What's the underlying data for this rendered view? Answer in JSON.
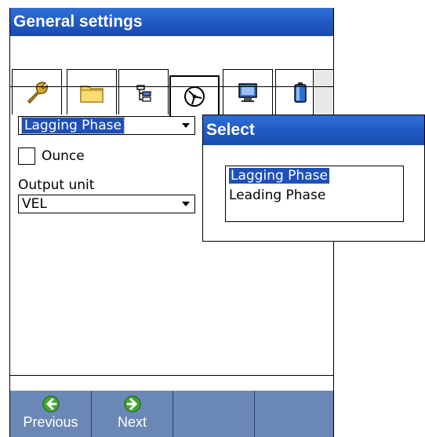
{
  "window": {
    "title": "General settings"
  },
  "tabs": [
    {
      "icon": "wrench-icon"
    },
    {
      "icon": "folder-icon"
    },
    {
      "icon": "tree-icon"
    },
    {
      "icon": "phase-icon",
      "active": true
    },
    {
      "icon": "monitor-icon"
    },
    {
      "icon": "battery-icon"
    }
  ],
  "form": {
    "phase_value": "Lagging Phase",
    "ounce_label": "Ounce",
    "ounce_checked": false,
    "output_unit_label": "Output unit",
    "output_unit_value": "VEL"
  },
  "softkeys": {
    "previous_label": "Previous",
    "next_label": "Next"
  },
  "popup": {
    "title": "Select",
    "options": [
      {
        "label": "Lagging Phase",
        "selected": true
      },
      {
        "label": "Leading Phase",
        "selected": false
      }
    ]
  },
  "colors": {
    "titlebar": "#1f57c0",
    "selection": "#1f4fb8",
    "softbar": "#6b87b5",
    "go_icon": "#3fa82a"
  }
}
